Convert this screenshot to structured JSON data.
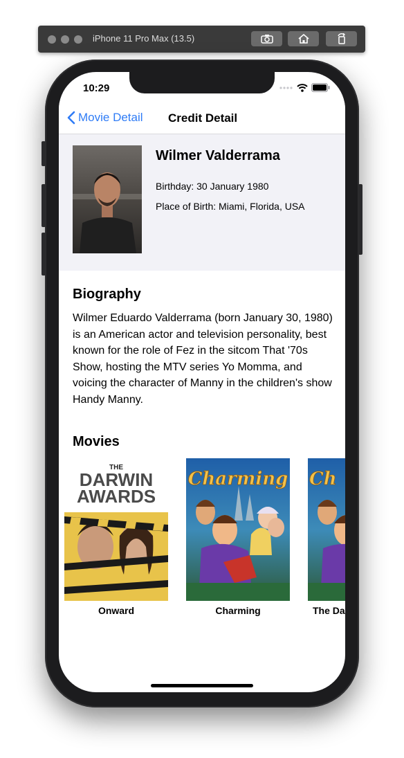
{
  "simulator": {
    "title": "iPhone 11 Pro Max (13.5)"
  },
  "status_bar": {
    "time": "10:29"
  },
  "nav": {
    "back_label": "Movie Detail",
    "title": "Credit Detail"
  },
  "person": {
    "name": "Wilmer Valderrama",
    "birthday": "Birthday: 30 January 1980",
    "place_of_birth": "Place of Birth: Miami, Florida, USA"
  },
  "biography": {
    "heading": "Biography",
    "text": "Wilmer Eduardo Valderrama (born January 30, 1980) is an American actor and television personality, best known for the role of Fez in the sitcom That '70s Show, hosting the MTV series Yo Momma, and voicing the character of Manny in the children's show Handy Manny."
  },
  "movies": {
    "heading": "Movies",
    "items": [
      {
        "label": "Onward",
        "poster_title_line1": "THE",
        "poster_title_line2": "DARWIN",
        "poster_title_line3": "AWARDS"
      },
      {
        "label": "Charming",
        "poster_title": "Charming"
      },
      {
        "label": "The Da",
        "poster_title": "Ch"
      }
    ]
  }
}
